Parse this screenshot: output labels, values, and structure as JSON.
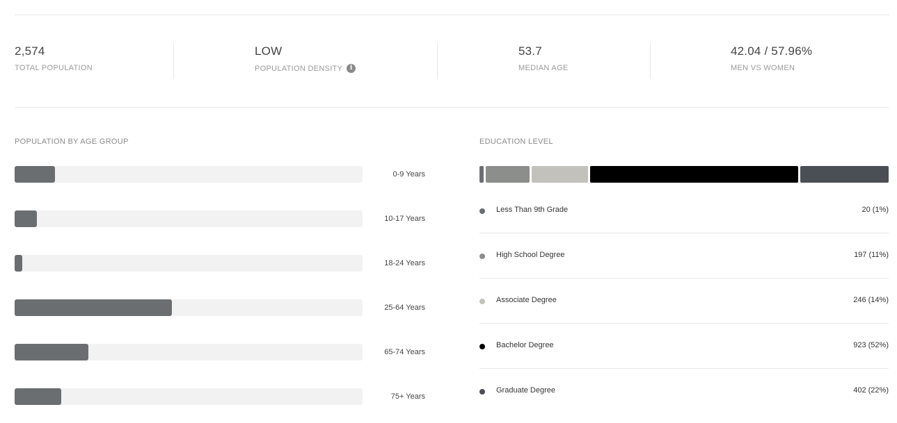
{
  "stats": [
    {
      "value": "2,574",
      "label": "TOTAL POPULATION"
    },
    {
      "value": "LOW",
      "label": "POPULATION DENSITY",
      "icon": "info-icon"
    },
    {
      "value": "53.7",
      "label": "MEDIAN AGE"
    },
    {
      "value": "42.04 / 57.96%",
      "label": "MEN VS WOMEN"
    }
  ],
  "age_section": {
    "title": "POPULATION BY AGE GROUP",
    "groups": [
      {
        "label": "0-9 Years",
        "fraction": 0.116
      },
      {
        "label": "10-17 Years",
        "fraction": 0.064
      },
      {
        "label": "18-24 Years",
        "fraction": 0.022
      },
      {
        "label": "25-64 Years",
        "fraction": 0.452
      },
      {
        "label": "65-74 Years",
        "fraction": 0.212
      },
      {
        "label": "75+ Years",
        "fraction": 0.134
      }
    ]
  },
  "education_section": {
    "title": "EDUCATION LEVEL",
    "levels": [
      {
        "name": "Less Than 9th Grade",
        "count_text": "20 (1%)",
        "share": 0.01,
        "color": "#6b6e71"
      },
      {
        "name": "High School Degree",
        "count_text": "197 (11%)",
        "share": 0.11,
        "color": "#8c8e8b"
      },
      {
        "name": "Associate Degree",
        "count_text": "246 (14%)",
        "share": 0.14,
        "color": "#c3c1bb"
      },
      {
        "name": "Bachelor Degree",
        "count_text": "923 (52%)",
        "share": 0.52,
        "color": "#000000"
      },
      {
        "name": "Graduate Degree",
        "count_text": "402 (22%)",
        "share": 0.22,
        "color": "#4a4f56"
      }
    ]
  }
}
